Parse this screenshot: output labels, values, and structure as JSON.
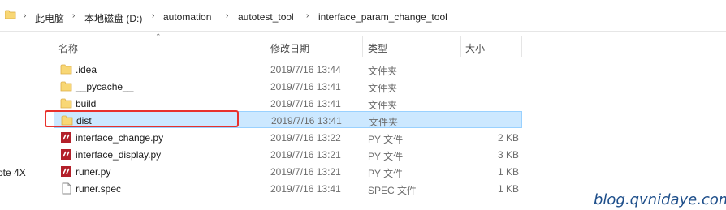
{
  "breadcrumb": {
    "items": [
      "此电脑",
      "本地磁盘 (D:)",
      "automation",
      "autotest_tool",
      "interface_param_change_tool"
    ],
    "separator": "›"
  },
  "columns": {
    "name": "名称",
    "date": "修改日期",
    "type": "类型",
    "size": "大小"
  },
  "left_pane_fragment": "ote 4X",
  "files": [
    {
      "name": ".idea",
      "date": "2019/7/16 13:44",
      "type": "文件夹",
      "size": "",
      "icon": "folder-icon"
    },
    {
      "name": "__pycache__",
      "date": "2019/7/16 13:41",
      "type": "文件夹",
      "size": "",
      "icon": "folder-icon"
    },
    {
      "name": "build",
      "date": "2019/7/16 13:41",
      "type": "文件夹",
      "size": "",
      "icon": "folder-icon"
    },
    {
      "name": "dist",
      "date": "2019/7/16 13:41",
      "type": "文件夹",
      "size": "",
      "icon": "folder-icon",
      "selected": true
    },
    {
      "name": "interface_change.py",
      "date": "2019/7/16 13:22",
      "type": "PY 文件",
      "size": "2 KB",
      "icon": "python-file-icon"
    },
    {
      "name": "interface_display.py",
      "date": "2019/7/16 13:21",
      "type": "PY 文件",
      "size": "3 KB",
      "icon": "python-file-icon"
    },
    {
      "name": "runer.py",
      "date": "2019/7/16 13:21",
      "type": "PY 文件",
      "size": "1 KB",
      "icon": "python-file-icon"
    },
    {
      "name": "runer.spec",
      "date": "2019/7/16 13:41",
      "type": "SPEC 文件",
      "size": "1 KB",
      "icon": "generic-file-icon"
    }
  ],
  "watermark": "blog.qvnidaye.com",
  "colors": {
    "selection": "#cce8ff",
    "highlight_box": "#e8312c",
    "folder": "#f8d775",
    "python": "#b3202a",
    "watermark": "#1d4e8a"
  }
}
